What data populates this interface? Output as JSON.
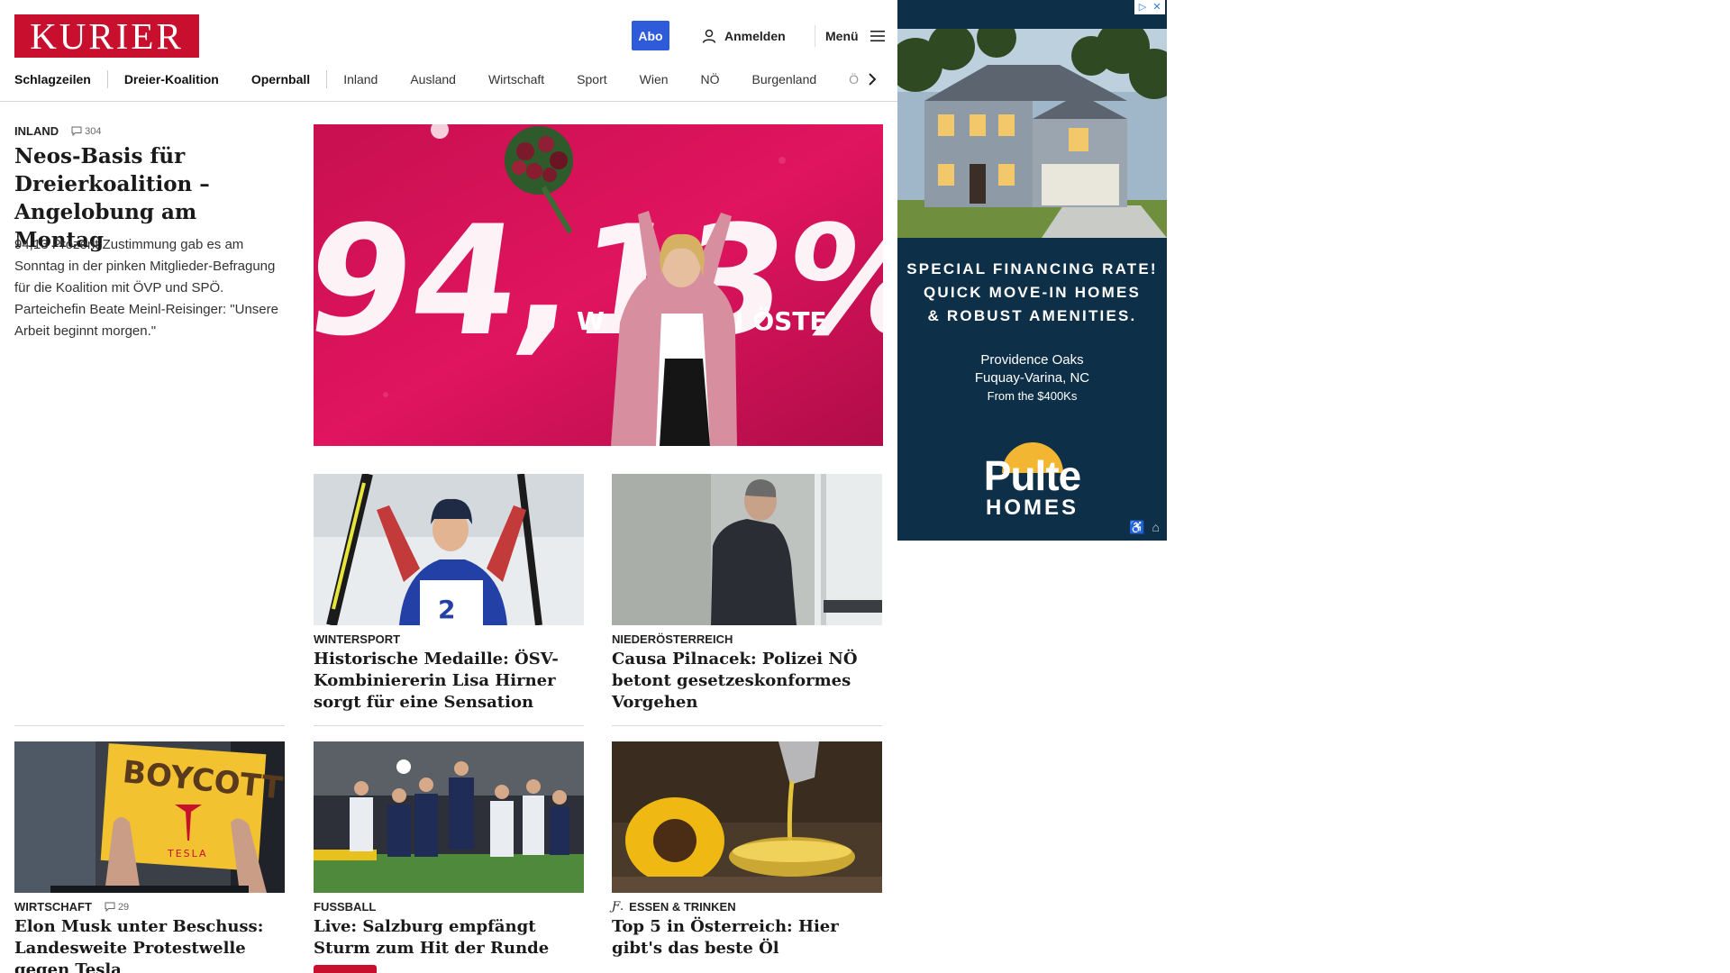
{
  "header": {
    "logo": "KURIER",
    "abo": "Abo",
    "login": "Anmelden",
    "menu": "Menü"
  },
  "nav": {
    "items": [
      "Schlagzeilen",
      "Dreier-Koalition",
      "Opernball",
      "Inland",
      "Ausland",
      "Wirtschaft",
      "Sport",
      "Wien",
      "NÖ",
      "Burgenland",
      "Ö"
    ]
  },
  "lead": {
    "kicker": "INLAND",
    "comments": "304",
    "title": "Neos-Basis für Dreierkoalition – Angelobung am Montag",
    "teaser": "94,13 Prozent Zustimmung gab es am Sonntag in der pinken Mitglieder-Befragung für die Koalition mit ÖVP und SPÖ. Parteichefin Beate Meinl-Reisinger: \"Unsere Arbeit beginnt morgen.\"",
    "image_text": "94,13%",
    "image_banner": "W     EUERN ÖSTE"
  },
  "cards": [
    {
      "kicker": "WINTERSPORT",
      "title": "Historische Medaille: ÖSV-Kombiniererin Lisa Hirner sorgt für eine Sensation"
    },
    {
      "kicker": "NIEDERÖSTERREICH",
      "title": "Causa Pilnacek: Polizei NÖ betont gesetzeskonformes Vorgehen"
    },
    {
      "kicker": "WIRTSCHAFT",
      "comments": "29",
      "title": "Elon Musk unter Beschuss: Landesweite Protestwelle gegen Tesla",
      "image_text": "BOYCOTT",
      "image_subtext": "TESLA"
    },
    {
      "kicker": "FUSSBALL",
      "title": "Live: Salzburg empfängt Sturm zum Hit der Runde"
    },
    {
      "kicker": "ESSEN & TRINKEN",
      "title": "Top 5 in Österreich: Hier gibt's das beste Öl"
    }
  ],
  "ad": {
    "headline_1": "SPECIAL FINANCING RATE!",
    "headline_2": "QUICK MOVE-IN HOMES",
    "headline_3": "& ROBUST AMENITIES.",
    "place_1": "Providence Oaks",
    "place_2": "Fuquay-Varina, NC",
    "price": "From the $400Ks",
    "brand_1": "Pulte",
    "brand_2": "HOMES",
    "close_icons": [
      "ad-choices-icon",
      "close-icon"
    ],
    "icons": [
      "accessibility-icon",
      "equal-housing-icon"
    ]
  },
  "colors": {
    "brand": "#c8102e",
    "abo": "#2e5bd9",
    "ad_bg": "#0d2f47",
    "pink": "#e0145f"
  }
}
